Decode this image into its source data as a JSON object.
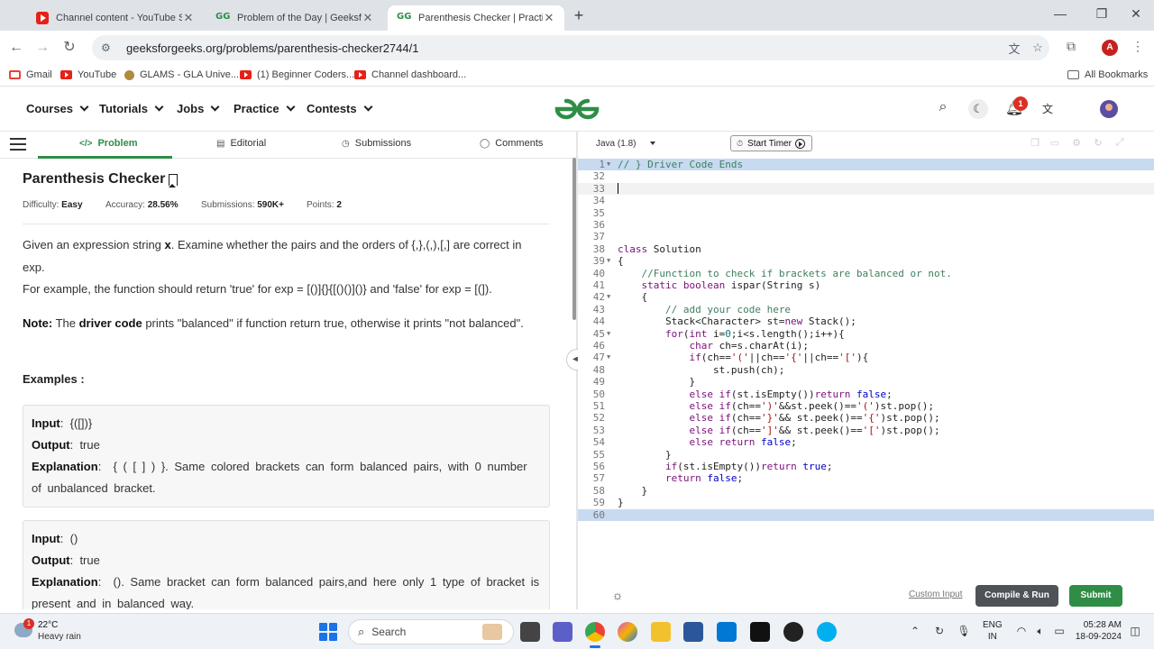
{
  "browser": {
    "tabs": [
      {
        "title": "Channel content - YouTube Stu",
        "icon": "youtube-icon",
        "active": false
      },
      {
        "title": "Problem of the Day | GeeksforG",
        "icon": "gfg-icon",
        "active": false
      },
      {
        "title": "Parenthesis Checker | Practice |",
        "icon": "gfg-icon",
        "active": true
      }
    ],
    "url": "geeksforgeeks.org/problems/parenthesis-checker2744/1",
    "profile_initial": "A",
    "bookmarks": [
      "Gmail",
      "YouTube",
      "GLAMS - GLA Unive...",
      "(1) Beginner Coders...",
      "Channel dashboard..."
    ],
    "all_bookmarks": "All Bookmarks"
  },
  "site": {
    "nav": [
      "Courses",
      "Tutorials",
      "Jobs",
      "Practice",
      "Contests"
    ],
    "notification_count": "1",
    "brand_color": "#2f8d46"
  },
  "problem": {
    "tabs": [
      "Problem",
      "Editorial",
      "Submissions",
      "Comments"
    ],
    "title": "Parenthesis Checker",
    "difficulty_label": "Difficulty:",
    "difficulty": "Easy",
    "accuracy_label": "Accuracy:",
    "accuracy": "28.56%",
    "submissions_label": "Submissions:",
    "submissions": "590K+",
    "points_label": "Points:",
    "points": "2",
    "desc_1a": "Given an expression string ",
    "desc_1b": "x",
    "desc_1c": ". Examine whether the pairs and the orders of {,},(,),[,] are correct in exp.",
    "desc_2": "For example, the function should return 'true' for exp = [()]{}{[()()]()} and 'false' for exp = [(]).",
    "note_label": "Note:",
    "note_a": " The ",
    "note_b": "driver code",
    "note_c": " prints \"balanced\" if function return true, otherwise it prints \"not balanced\".",
    "examples_heading": "Examples :",
    "examples": [
      {
        "input": "{([])}",
        "output": "true",
        "explanation": "{ ( [ ] ) }. Same colored brackets can form balanced pairs, with 0 number of unbalanced bracket."
      },
      {
        "input": "()",
        "output": "true",
        "explanation": "(). Same bracket can form balanced pairs,and here only 1 type of bracket is present and in balanced way."
      }
    ],
    "input_label": "Input",
    "output_label": "Output",
    "explanation_label": "Explanation"
  },
  "editor": {
    "language": "Java (1.8)",
    "timer_label": "Start Timer",
    "custom_input": "Custom Input",
    "compile_run": "Compile & Run",
    "submit": "Submit",
    "lines": [
      {
        "n": "1",
        "fold": true,
        "hl": "blue",
        "html": "<span class='cm'>// } Driver Code Ends</span>"
      },
      {
        "n": "32",
        "html": ""
      },
      {
        "n": "33",
        "hl": "cur",
        "html": ""
      },
      {
        "n": "34",
        "html": ""
      },
      {
        "n": "35",
        "html": ""
      },
      {
        "n": "36",
        "html": ""
      },
      {
        "n": "37",
        "html": ""
      },
      {
        "n": "38",
        "html": "<span class='kw'>class</span> Solution"
      },
      {
        "n": "39",
        "fold": true,
        "html": "{"
      },
      {
        "n": "40",
        "html": "    <span class='cm'>//Function to check if brackets are balanced or not.</span>"
      },
      {
        "n": "41",
        "html": "    <span class='kw'>static</span> <span class='kw'>boolean</span> ispar(String s)"
      },
      {
        "n": "42",
        "fold": true,
        "html": "    {"
      },
      {
        "n": "43",
        "html": "        <span class='cm'>// add your code here</span>"
      },
      {
        "n": "44",
        "html": "        Stack&lt;Character&gt; st=<span class='kw'>new</span> Stack();"
      },
      {
        "n": "45",
        "fold": true,
        "html": "        <span class='kw'>for</span>(<span class='kw'>int</span> i=<span class='nm'>0</span>;i&lt;s.length();i++){"
      },
      {
        "n": "46",
        "html": "            <span class='kw'>char</span> ch=s.charAt(i);"
      },
      {
        "n": "47",
        "fold": true,
        "html": "            <span class='kw'>if</span>(ch==<span class='st'>'('</span>||ch==<span class='st'>'{'</span>||ch==<span class='st'>'['</span>){"
      },
      {
        "n": "48",
        "html": "                st.push(ch);"
      },
      {
        "n": "49",
        "html": "            }"
      },
      {
        "n": "50",
        "html": "            <span class='kw'>else</span> <span class='kw'>if</span>(st.isEmpty())<span class='kw'>return</span> <span class='kb'>false</span>;"
      },
      {
        "n": "51",
        "html": "            <span class='kw'>else</span> <span class='kw'>if</span>(ch==<span class='st'>')'</span>&amp;&amp;st.peek()==<span class='st'>'('</span>)st.pop();"
      },
      {
        "n": "52",
        "html": "            <span class='kw'>else</span> <span class='kw'>if</span>(ch==<span class='st'>'}'</span>&amp;&amp; st.peek()==<span class='st'>'{'</span>)st.pop();"
      },
      {
        "n": "53",
        "html": "            <span class='kw'>else</span> <span class='kw'>if</span>(ch==<span class='st'>']'</span>&amp;&amp; st.peek()==<span class='st'>'['</span>)st.pop();"
      },
      {
        "n": "54",
        "html": "            <span class='kw'>else</span> <span class='kw'>return</span> <span class='kb'>false</span>;"
      },
      {
        "n": "55",
        "html": "        }"
      },
      {
        "n": "56",
        "html": "        <span class='kw'>if</span>(st.isEmpty())<span class='kw'>return</span> <span class='kb'>true</span>;"
      },
      {
        "n": "57",
        "html": "        <span class='kw'>return</span> <span class='kb'>false</span>;"
      },
      {
        "n": "58",
        "html": "    }"
      },
      {
        "n": "59",
        "html": "}"
      },
      {
        "n": "60",
        "hl": "blue",
        "html": ""
      }
    ]
  },
  "taskbar": {
    "weather_badge": "1",
    "temperature": "22°C",
    "weather": "Heavy rain",
    "search_placeholder": "Search",
    "lang_1": "ENG",
    "lang_2": "IN",
    "time": "05:28 AM",
    "date": "18-09-2024"
  }
}
